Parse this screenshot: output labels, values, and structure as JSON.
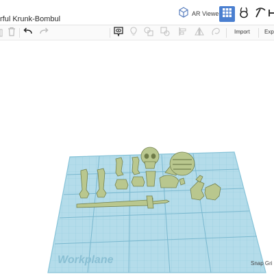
{
  "header": {
    "title": "rful Krunk-Bombul",
    "ar_viewer_label": "AR Viewer"
  },
  "toolbar": {
    "import_label": "Import",
    "export_label": "Expo"
  },
  "workplane": {
    "label": "Workplane",
    "snap_grid_label": "Snap Gri"
  },
  "colors": {
    "accent": "#4a7fd0",
    "workplane_fill": "#a8d6e6",
    "grid_line": "#7fc0d8",
    "model": "#b9c78e",
    "model_shadow": "#7e8c5a"
  },
  "icons": {
    "ar": "cube-3d-icon",
    "grid": "grid-view-icon",
    "brush": "brush-icon",
    "pickaxe": "pickaxe-icon",
    "trash": "trash-icon",
    "undo": "undo-icon",
    "redo": "redo-icon"
  }
}
